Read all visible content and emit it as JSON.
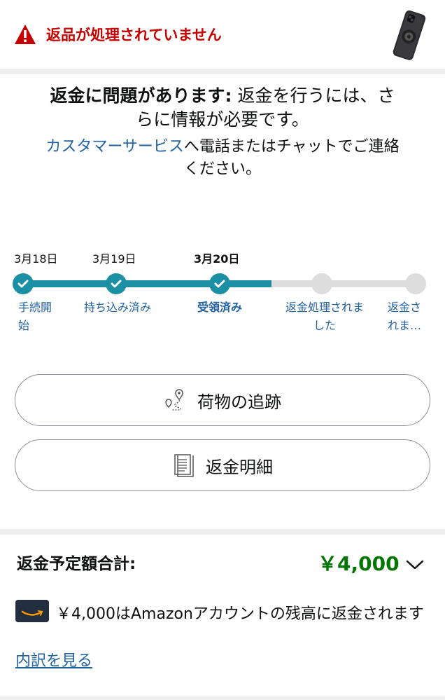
{
  "alert": {
    "message": "返品が処理されていません",
    "icon": "warning-icon",
    "color": "#c40000"
  },
  "product": {
    "image": "phone-case-thumbnail"
  },
  "problem": {
    "bold": "返金に問題があります:",
    "text": " 返金を行うには、さらに情報が必要です。",
    "link": "カスタマーサービス",
    "contact_text": "へ電話またはチャットでご連絡ください。"
  },
  "progress": {
    "steps": [
      {
        "date": "3月18日",
        "label_line1": "手続開",
        "label_line2": "始",
        "state": "done"
      },
      {
        "date": "3月19日",
        "label_line1": "持ち込み済み",
        "label_line2": "",
        "state": "done"
      },
      {
        "date": "3月20日",
        "label_line1": "受領済み",
        "label_line2": "",
        "state": "current"
      },
      {
        "date": "",
        "label_line1": "返金処理されま",
        "label_line2": "した",
        "state": "todo"
      },
      {
        "date": "",
        "label_line1": "返金さ",
        "label_line2": "れま…",
        "state": "todo"
      }
    ],
    "completed_fraction": 0.6,
    "accent": "#1b8fa3"
  },
  "actions": {
    "track_label": "荷物の追跡",
    "track_icon": "map-route-icon",
    "refund_details_label": "返金明細",
    "refund_details_icon": "receipt-icon"
  },
  "total": {
    "label": "返金予定額合計:",
    "amount": "￥4,000",
    "amount_color": "#007600"
  },
  "refund_method": {
    "icon": "amazon-card-icon",
    "text": "￥4,000はAmazonアカウントの残高に返金されます",
    "breakdown_link": "内訳を見る"
  }
}
